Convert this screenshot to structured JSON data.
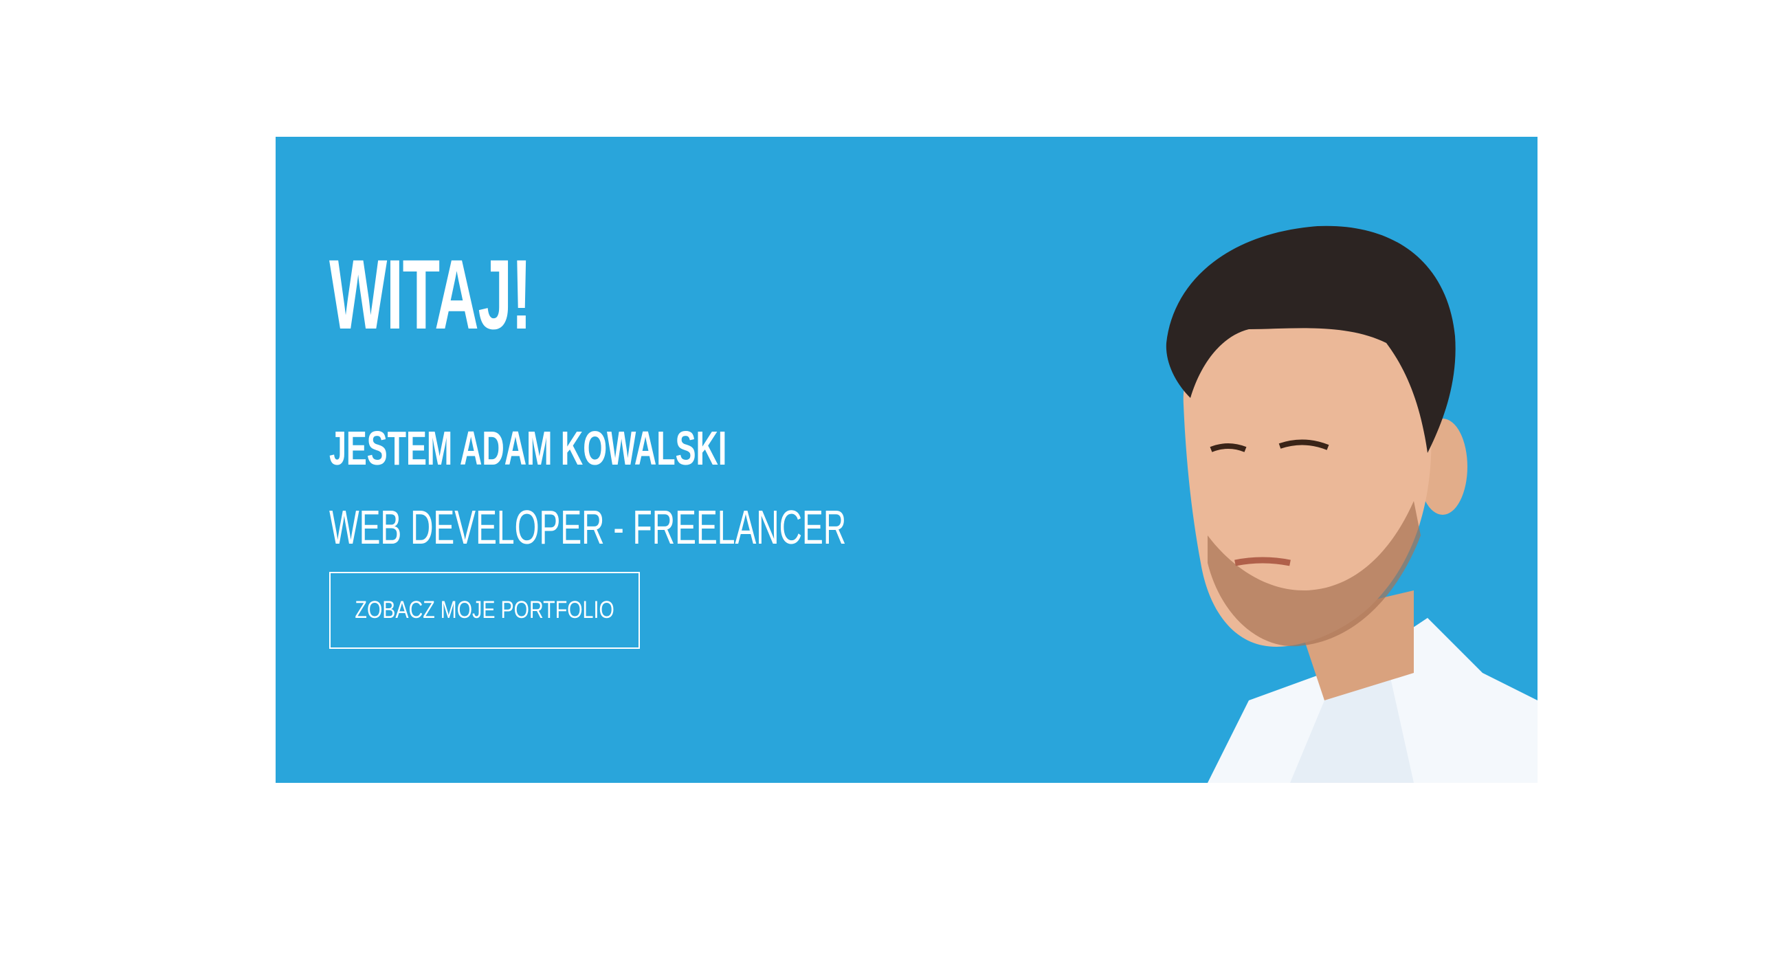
{
  "hero": {
    "title": "WITAJ!",
    "name": "JESTEM ADAM KOWALSKI",
    "role": "WEB DEVELOPER - FREELANCER",
    "cta_label": "ZOBACZ MOJE PORTFOLIO",
    "background_color": "#29a5db"
  }
}
